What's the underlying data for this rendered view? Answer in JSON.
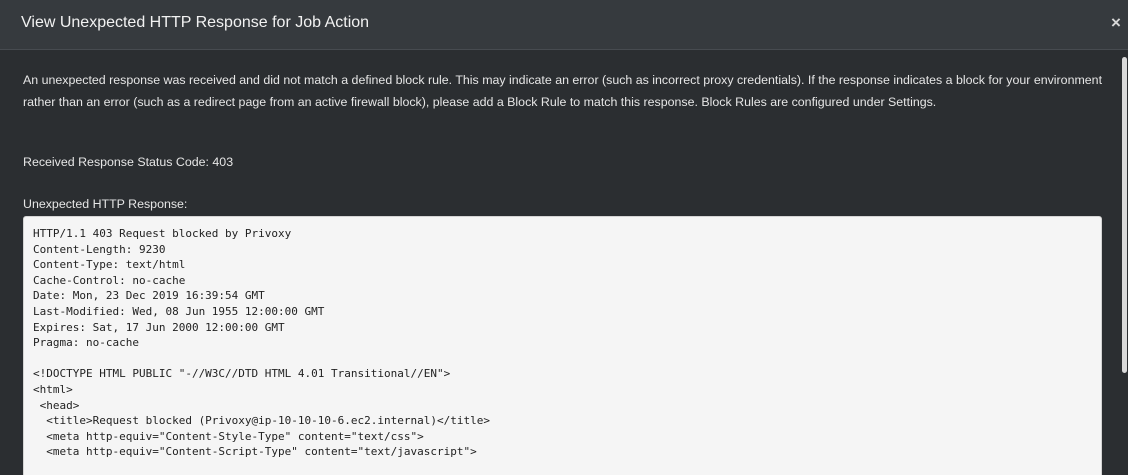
{
  "dialog": {
    "title": "View Unexpected HTTP Response for Job Action",
    "close_glyph": "×",
    "close_icon": "close-icon"
  },
  "content": {
    "description": "An unexpected response was received and did not match a defined block rule. This may indicate an error (such as incorrect proxy credentials). If the response indicates a block for your environment rather than an error (such as a redirect page from an active firewall block), please add a Block Rule to match this response. Block Rules are configured under Settings.",
    "status_text": "Received Response Status Code: 403",
    "response_label": "Unexpected HTTP Response:"
  },
  "response_lines": [
    "HTTP/1.1 403 Request blocked by Privoxy",
    "Content-Length: 9230",
    "Content-Type: text/html",
    "Cache-Control: no-cache",
    "Date: Mon, 23 Dec 2019 16:39:54 GMT",
    "Last-Modified: Wed, 08 Jun 1955 12:00:00 GMT",
    "Expires: Sat, 17 Jun 2000 12:00:00 GMT",
    "Pragma: no-cache",
    "",
    "<!DOCTYPE HTML PUBLIC \"-//W3C//DTD HTML 4.01 Transitional//EN\">",
    "<html>",
    " <head>",
    "  <title>Request blocked (Privoxy@ip-10-10-10-6.ec2.internal)</title>",
    "  <meta http-equiv=\"Content-Style-Type\" content=\"text/css\">",
    "  <meta http-equiv=\"Content-Script-Type\" content=\"text/javascript\">"
  ],
  "colors": {
    "background": "#2b2e31",
    "titlebar": "#363a3e",
    "code_background": "#f5f5f5"
  }
}
